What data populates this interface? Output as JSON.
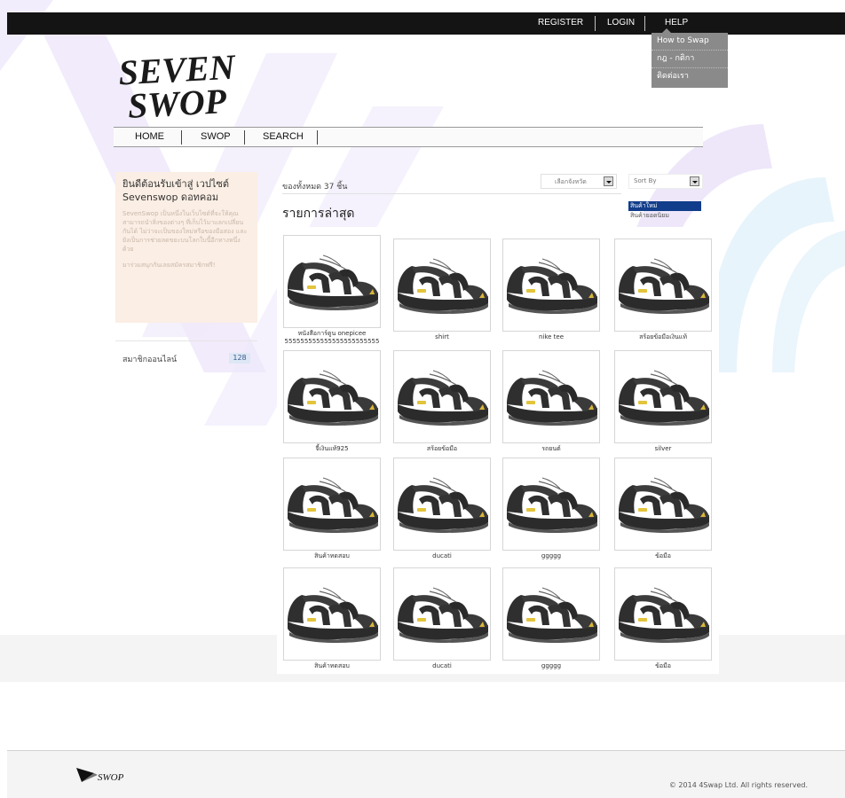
{
  "topbar": {
    "register": "REGISTER",
    "login": "LOGIN",
    "help": "HELP"
  },
  "help_menu": [
    "How to Swap",
    "กฎ - กติกา",
    "ติดต่อเรา"
  ],
  "logo": {
    "line1": "SEVEN",
    "line2": "SWOP"
  },
  "nav": {
    "home": "HOME",
    "swop": "SWOP",
    "search": "SEARCH"
  },
  "welcome": {
    "title": "ยินดีต้อนรับเข้าสู่ เวปไซต์ Sevenswop ดอทคอม",
    "body": "SevenSwop เป็นหนึ่งในเว็บไซต์ที่จะให้คุณสามารถนำสิ่งของต่างๆ ที่เก็บไว้มาแลกเปลี่ยนกันได้ ไม่ว่าจะเป็นของใหม่หรือของมือสอง และยังเป็นการช่วยลดขยะบนโลกใบนี้อีกทางหนึ่งด้วย",
    "footer": "มาร่วมสนุกกันเลยสมัครสมาชิกฟรี!"
  },
  "members": {
    "label": "สมาชิกออนไลน์",
    "count": "128"
  },
  "content": {
    "total": "ของทั้งหมด 37 ชิ้น",
    "province_placeholder": "เลือกจังหวัด",
    "sort_label": "Sort By",
    "sort_options": [
      "สินค้าใหม่",
      "สินค้ายอดนิยม"
    ],
    "latest_title": "รายการล่าสุด"
  },
  "products": [
    "หนังสือการ์ตูน onepicee 555555555555555555555555",
    "shirt",
    "nike tee",
    "สร้อยข้อมือเงินแท้",
    "จี้เงินแท้925",
    "สร้อยข้อมือ",
    "รถยนต์",
    "silver",
    "สินค้าทดสอบ",
    "ducati",
    "ggggg",
    "ข้อมือ",
    "สินค้าทดสอบ",
    "ducati",
    "ggggg",
    "ข้อมือ"
  ],
  "footer": {
    "logo_text": "SWOP",
    "copyright": "© 2014 4Swap Ltd. All rights reserved."
  },
  "colors": {
    "topbar": "#141414",
    "welcome_bg": "#fbeee4",
    "deco_purple": "#ece6fa",
    "deco_blue": "#e7f3fb",
    "selected_sort": "#113d8a"
  }
}
